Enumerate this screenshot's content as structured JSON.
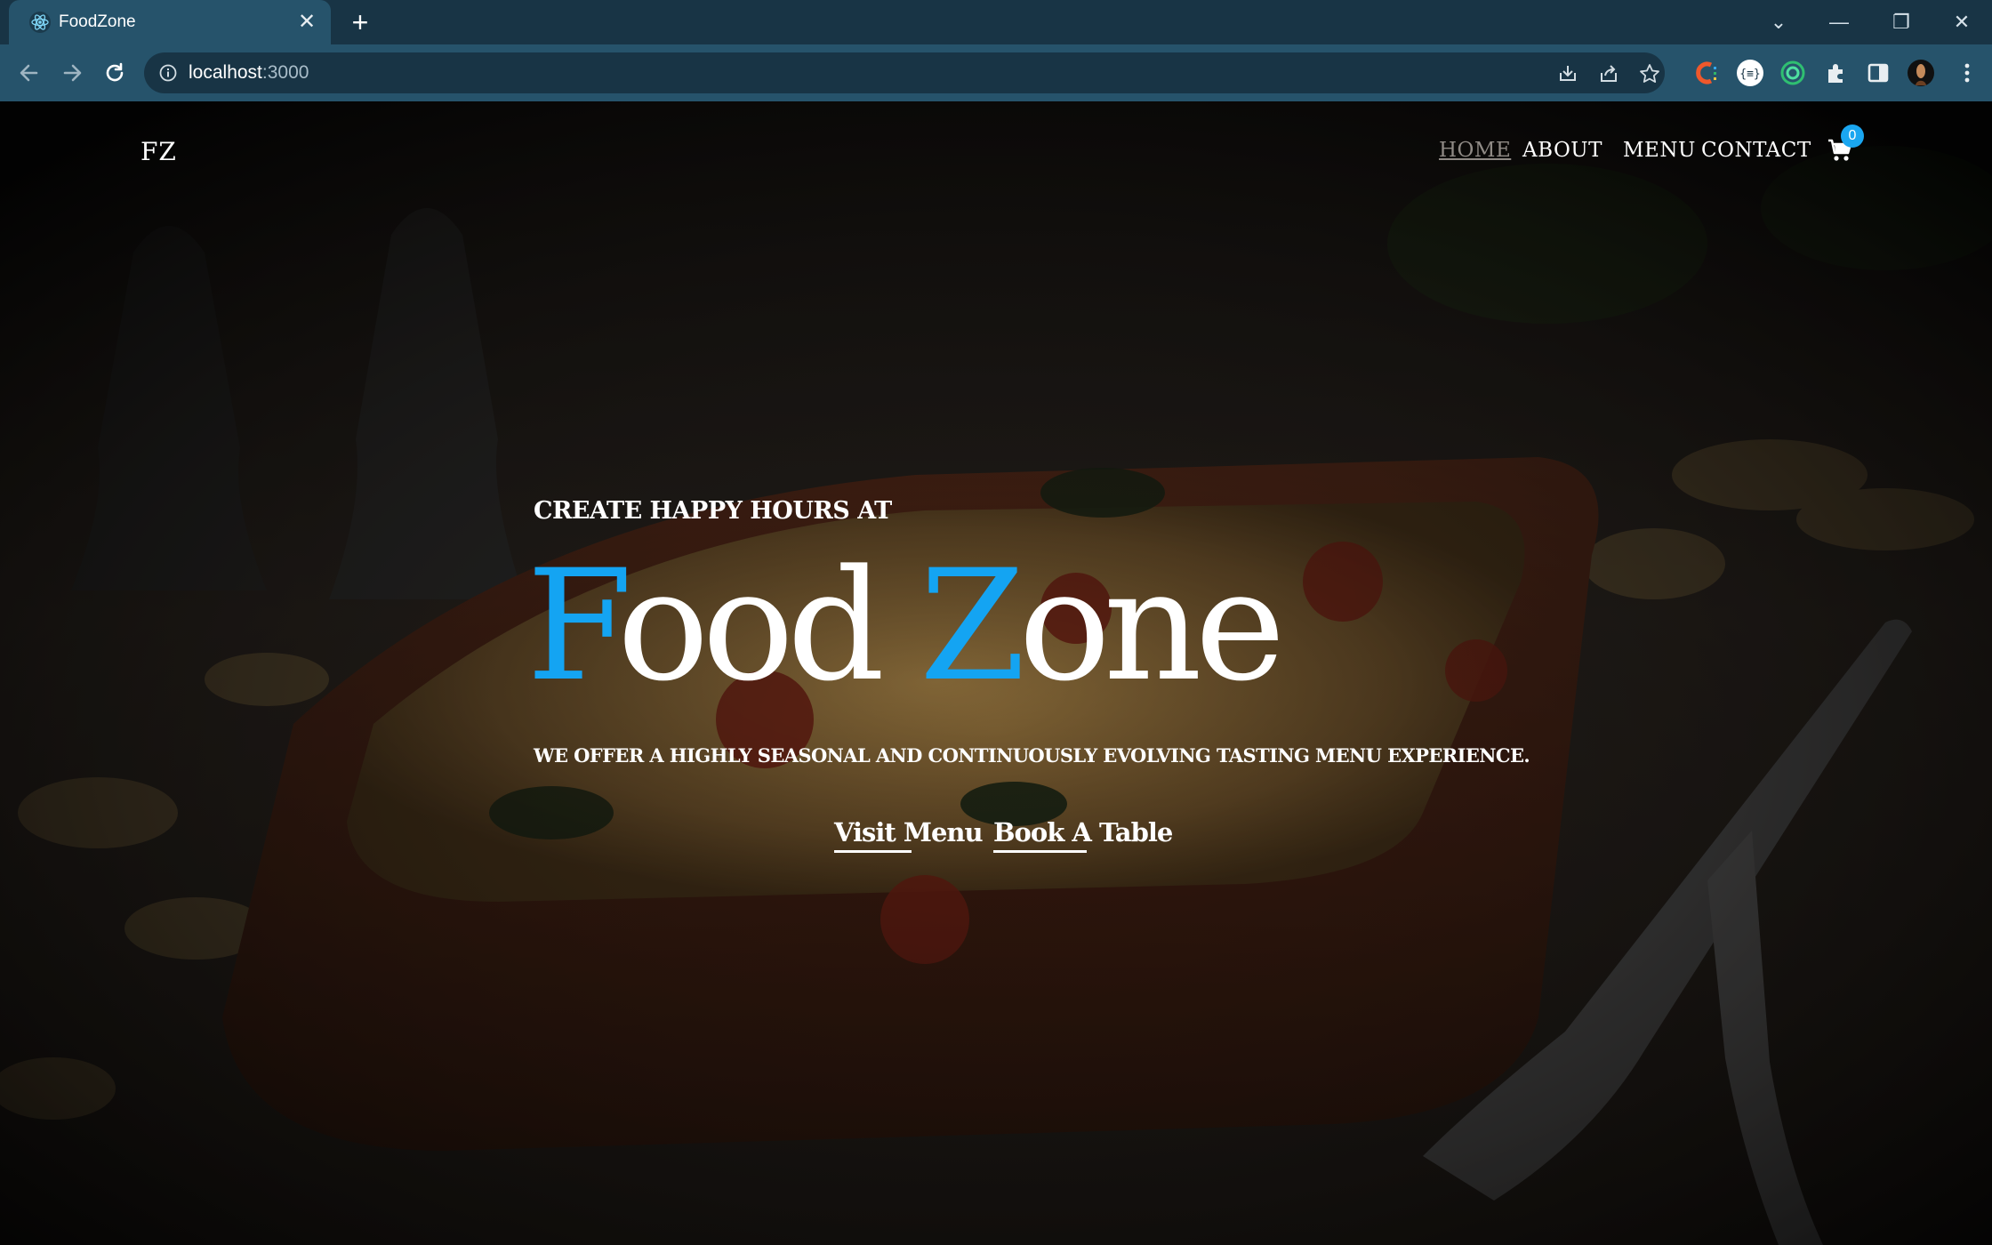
{
  "browser": {
    "tab_title": "FoodZone",
    "tab_close": "✕",
    "new_tab": "+",
    "url_host": "localhost",
    "url_port": ":3000",
    "window_controls": [
      "⌄",
      "—",
      "❐",
      "✕"
    ]
  },
  "nav": {
    "logo": "FZ",
    "links": [
      "HOME",
      "ABOUT",
      "MENU",
      "CONTACT"
    ],
    "active": "HOME",
    "cart_count": "0"
  },
  "hero": {
    "tagline": "CREATE HAPPY HOURS AT",
    "title_first_letter": "F",
    "title_first_rest": "ood ",
    "title_second_letter": "Z",
    "title_second_rest": "one",
    "subtext": "WE OFFER A HIGHLY SEASONAL AND CONTINUOUSLY EVOLVING TASTING MENU EXPERIENCE.",
    "cta_primary": "Visit Menu",
    "cta_secondary": "Book A Table"
  },
  "colors": {
    "accent": "#14a4f2",
    "chrome_dark": "#183445",
    "chrome_light": "#26536b"
  },
  "icons": [
    "react-icon",
    "back-icon",
    "forward-icon",
    "reload-icon",
    "info-icon",
    "install-icon",
    "share-icon",
    "star-icon",
    "extensions-icon",
    "sidepanel-icon",
    "menu-icon",
    "cart-icon"
  ]
}
